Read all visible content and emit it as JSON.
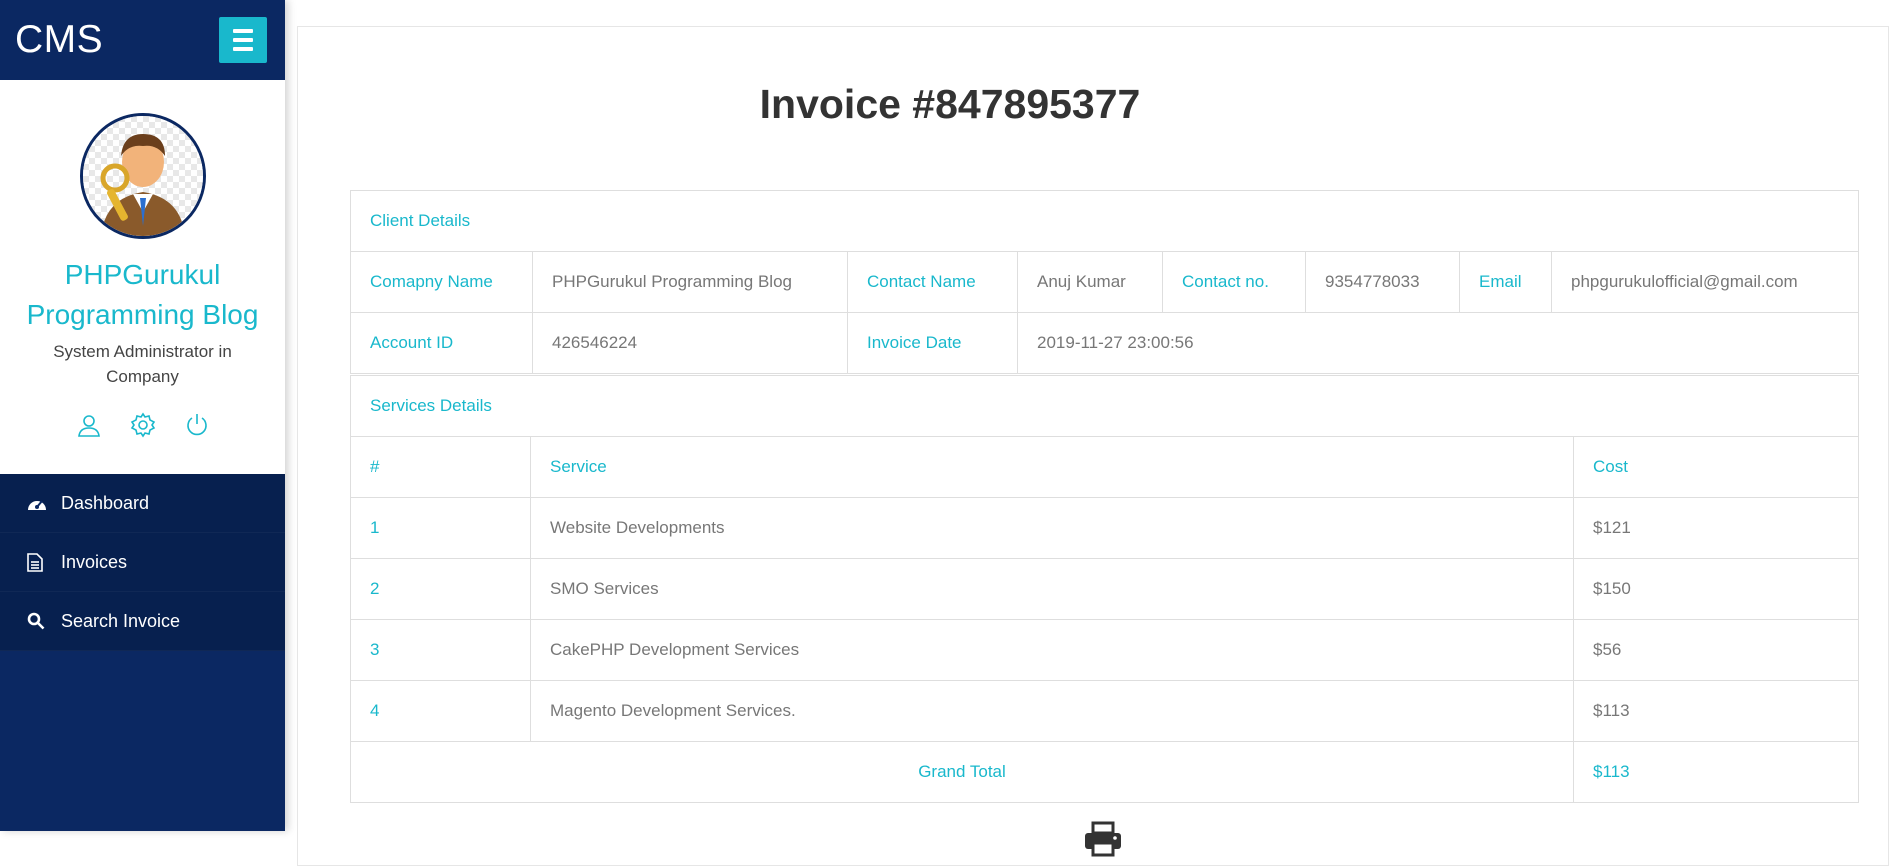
{
  "app": {
    "brand": "CMS"
  },
  "profile": {
    "name": "PHPGurukul Programming Blog",
    "role": "System Administrator in Company"
  },
  "icons": {
    "menu": "menu-icon",
    "user": "user-icon",
    "settings": "gear-icon",
    "logout": "power-icon",
    "dashboard": "dashboard-icon",
    "invoices": "document-icon",
    "search": "search-icon",
    "print": "printer-icon"
  },
  "nav": {
    "items": [
      {
        "label": "Dashboard"
      },
      {
        "label": "Invoices"
      },
      {
        "label": "Search Invoice"
      }
    ]
  },
  "invoice": {
    "title": "Invoice #847895377",
    "client_header": "Client Details",
    "company_label": "Comapny Name",
    "company_value": "PHPGurukul Programming Blog",
    "contact_name_label": "Contact Name",
    "contact_name_value": "Anuj Kumar",
    "contact_no_label": "Contact no.",
    "contact_no_value": "9354778033",
    "email_label": "Email",
    "email_value": "phpgurukulofficial@gmail.com",
    "account_label": "Account ID",
    "account_value": "426546224",
    "date_label": "Invoice Date",
    "date_value": "2019-11-27 23:00:56",
    "services_header": "Services Details",
    "columns": [
      "#",
      "Service",
      "Cost"
    ],
    "rows": [
      {
        "num": "1",
        "service": "Website Developments",
        "cost": "$121"
      },
      {
        "num": "2",
        "service": "SMO Services",
        "cost": "$150"
      },
      {
        "num": "3",
        "service": "CakePHP Development Services",
        "cost": "$56"
      },
      {
        "num": "4",
        "service": "Magento Development Services.",
        "cost": "$113"
      }
    ],
    "grand_total_label": "Grand Total",
    "grand_total_value": "$113"
  },
  "colors": {
    "sidebar": "#0b2862",
    "accent": "#19b8cc",
    "text_muted": "#777777"
  }
}
